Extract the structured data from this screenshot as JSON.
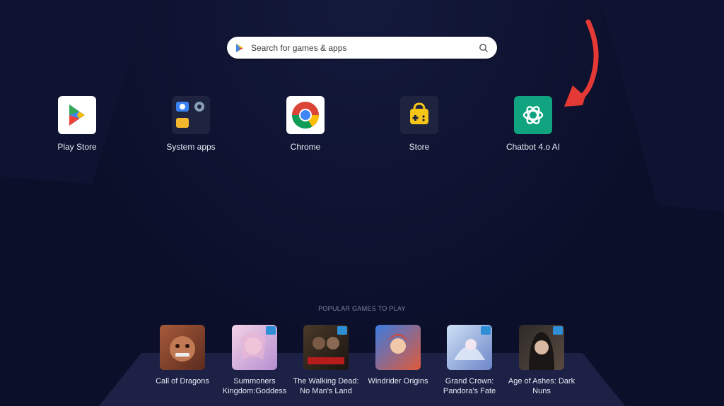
{
  "search": {
    "placeholder": "Search for games & apps"
  },
  "apps": [
    {
      "label": "Play Store",
      "icon": "play-store-icon"
    },
    {
      "label": "System apps",
      "icon": "system-apps-folder-icon"
    },
    {
      "label": "Chrome",
      "icon": "chrome-icon"
    },
    {
      "label": "Store",
      "icon": "store-bag-icon"
    },
    {
      "label": "Chatbot 4.o AI",
      "icon": "chatbot-icon"
    }
  ],
  "popular": {
    "heading": "POPULAR GAMES TO PLAY",
    "games": [
      {
        "line1": "Call of Dragons",
        "line2": ""
      },
      {
        "line1": "Summoners",
        "line2": "Kingdom:Goddess"
      },
      {
        "line1": "The Walking Dead:",
        "line2": "No Man's Land"
      },
      {
        "line1": "Windrider Origins",
        "line2": ""
      },
      {
        "line1": "Grand Crown:",
        "line2": "Pandora's Fate"
      },
      {
        "line1": "Age of Ashes: Dark",
        "line2": "Nuns"
      }
    ]
  },
  "colors": {
    "background": "#0b0f2a",
    "arrow": "#e53935",
    "chatbot": "#10a37f",
    "store_tile": "#1e2340"
  }
}
